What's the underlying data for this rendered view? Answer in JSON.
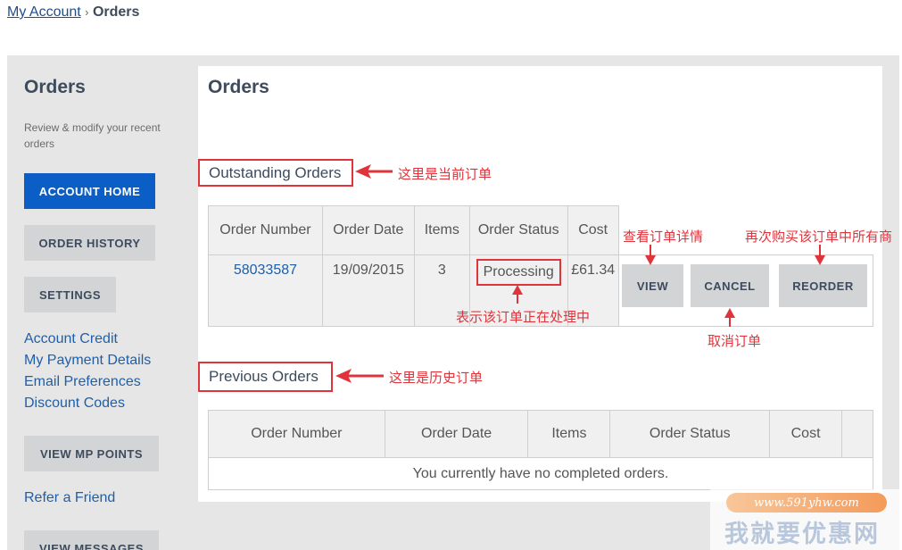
{
  "breadcrumb": {
    "home": "My Account",
    "sep": "›",
    "current": "Orders"
  },
  "sidebar": {
    "title": "Orders",
    "description": "Review & modify your recent orders",
    "buttons": {
      "account_home": "ACCOUNT HOME",
      "order_history": "ORDER HISTORY",
      "settings": "SETTINGS",
      "view_mp_points": "VIEW MP POINTS",
      "view_messages": "VIEW MESSAGES"
    },
    "links": {
      "account_credit": "Account Credit",
      "payment_details": "My Payment Details",
      "email_preferences": "Email Preferences",
      "discount_codes": "Discount Codes",
      "refer_friend": "Refer a Friend"
    }
  },
  "main": {
    "title": "Orders",
    "outstanding": {
      "heading": "Outstanding Orders",
      "headers": {
        "order_number": "Order Number",
        "order_date": "Order Date",
        "items": "Items",
        "order_status": "Order Status",
        "cost": "Cost"
      },
      "row": {
        "order_number": "58033587",
        "order_date": "19/09/2015",
        "items": "3",
        "status": "Processing",
        "cost": "£61.34"
      },
      "actions": {
        "view": "VIEW",
        "cancel": "CANCEL",
        "reorder": "REORDER"
      }
    },
    "previous": {
      "heading": "Previous Orders",
      "headers": {
        "order_number": "Order Number",
        "order_date": "Order Date",
        "items": "Items",
        "order_status": "Order Status",
        "cost": "Cost"
      },
      "empty": "You currently have no completed orders."
    }
  },
  "annotations": {
    "current_orders": "这里是当前订单",
    "view_details": "查看订单详情",
    "reorder_all": "再次购买该订单中所有商",
    "processing": "表示该订单正在处理中",
    "cancel": "取消订单",
    "history": "这里是历史订单"
  },
  "watermark": {
    "url": "www.591yhw.com",
    "name": "我就要优惠网"
  },
  "colors": {
    "primary_button": "#0c5ec7",
    "annotation_red": "#e0343c",
    "link_blue": "#1f5fa8"
  }
}
